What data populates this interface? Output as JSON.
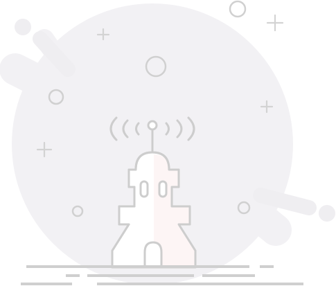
{
  "illustration": {
    "subject": "radio-tower-icon",
    "colors": {
      "backdrop": "#f2f1f4",
      "line": "#cdcdcd",
      "fill": "#ffffff",
      "tint": "#fdf5f5"
    }
  }
}
